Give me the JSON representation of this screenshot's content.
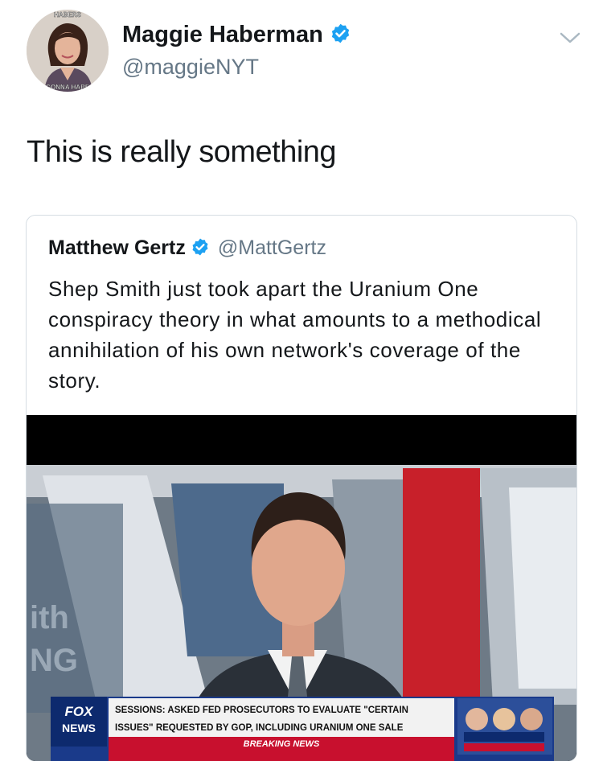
{
  "tweet": {
    "author": {
      "name": "Maggie Haberman",
      "handle": "@maggieNYT",
      "avatar_text_top": "HABERS",
      "avatar_text_bottom": "GONNA HABE"
    },
    "text": "This is really something"
  },
  "quoted_tweet": {
    "author": {
      "name": "Matthew Gertz",
      "handle": "@MattGertz"
    },
    "text": "Shep Smith just took apart the Uranium One conspiracy theory in what amounts to a methodical annihilation of his own network's coverage of the story.",
    "media": {
      "background_text_1": "ith",
      "background_text_2": "NG",
      "logo_line1": "FOX",
      "logo_line2": "NEWS",
      "ticker_line1": "SESSIONS: ASKED FED PROSECUTORS TO EVALUATE \"CERTAIN",
      "ticker_line2": "ISSUES\" REQUESTED BY GOP, INCLUDING URANIUM ONE SALE",
      "breaking": "BREAKING NEWS"
    }
  },
  "icons": {
    "verified": "verified-badge-icon",
    "more": "chevron-down-icon"
  },
  "colors": {
    "verified_blue": "#1da1f2",
    "handle_gray": "#657786",
    "text": "#14171a",
    "fox_red": "#c8102e",
    "fox_blue": "#1a3a8a"
  }
}
